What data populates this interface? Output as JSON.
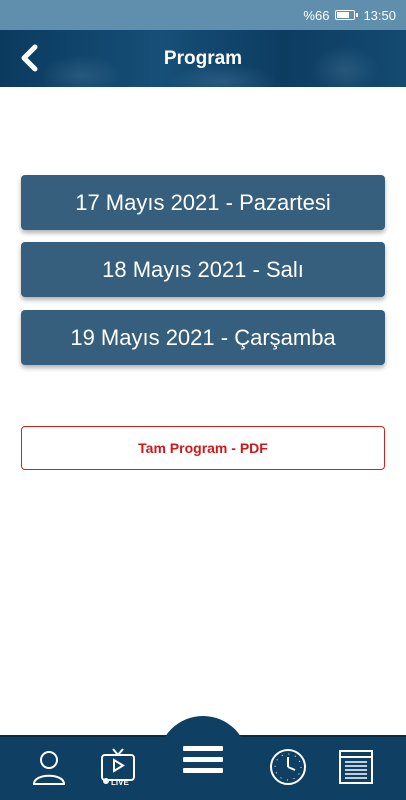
{
  "status_bar": {
    "battery": "%66",
    "time": "13:50"
  },
  "header": {
    "title": "Program",
    "back_icon": "chevron-left-icon"
  },
  "days": [
    {
      "label": "17 Mayıs 2021 - Pazartesi"
    },
    {
      "label": "18 Mayıs 2021 - Salı"
    },
    {
      "label": "19 Mayıs 2021 - Çarşamba"
    }
  ],
  "pdf_button": {
    "label": "Tam Program - PDF"
  },
  "bottom_nav": {
    "items": [
      {
        "icon": "user-icon"
      },
      {
        "icon": "live-tv-icon",
        "badge": "LIVE"
      },
      {
        "icon": "menu-icon"
      },
      {
        "icon": "clock-icon"
      },
      {
        "icon": "document-icon"
      }
    ]
  },
  "colors": {
    "header": "#0f3f63",
    "button": "#355f7d",
    "accent_red": "#d01818"
  }
}
